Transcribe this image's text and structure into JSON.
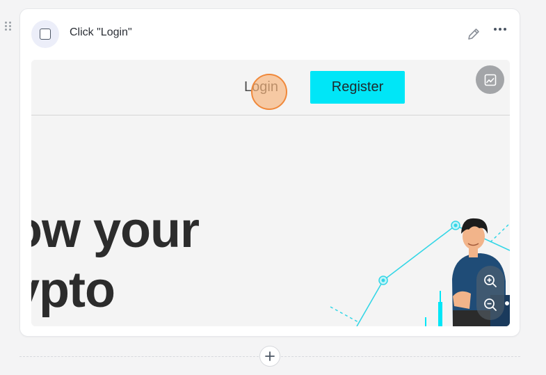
{
  "step": {
    "title": "Click \"Login\"",
    "completed": false
  },
  "screenshot": {
    "nav": {
      "login_label": "Login",
      "register_label": "Register"
    },
    "hero_text": "ow your\nypto"
  },
  "icons": {
    "drag": "drag-handle-icon",
    "edit": "pencil-icon",
    "more": "more-horizontal-icon",
    "edit_image": "image-edit-icon",
    "zoom_in": "zoom-in-icon",
    "zoom_out": "zoom-out-icon",
    "add": "plus-icon"
  },
  "colors": {
    "accent_cyan": "#00e6f7",
    "click_marker": "#f0883a",
    "badge_bg": "#eceef9"
  }
}
